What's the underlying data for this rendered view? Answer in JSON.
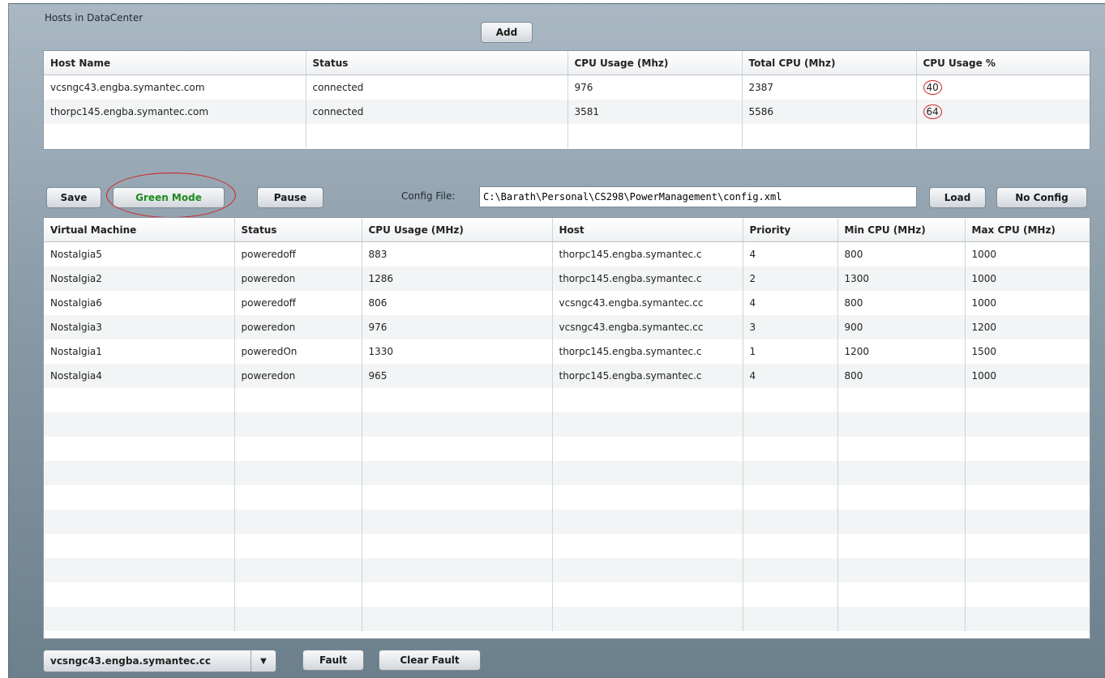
{
  "hosts": {
    "label": "Hosts in DataCenter",
    "add_label": "Add",
    "columns": [
      "Host Name",
      "Status",
      "CPU Usage (Mhz)",
      "Total CPU (Mhz)",
      "CPU Usage %"
    ],
    "rows": [
      [
        "vcsngc43.engba.symantec.com",
        "connected",
        "976",
        "2387",
        "40"
      ],
      [
        "thorpc145.engba.symantec.com",
        "connected",
        "3581",
        "5586",
        "64"
      ]
    ]
  },
  "toolbar": {
    "save_label": "Save",
    "green_mode_label": "Green Mode",
    "pause_label": "Pause",
    "config_file_label": "Config File:",
    "config_file_value": "C:\\Barath\\Personal\\CS298\\PowerManagement\\config.xml",
    "load_label": "Load",
    "no_config_label": "No Config"
  },
  "vms": {
    "columns": [
      "Virtual Machine",
      "Status",
      "CPU Usage (MHz)",
      "Host",
      "Priority",
      "Min CPU (MHz)",
      "Max CPU (MHz)"
    ],
    "rows": [
      [
        "Nostalgia5",
        "poweredoff",
        "883",
        "thorpc145.engba.symantec.c",
        "4",
        "800",
        "1000"
      ],
      [
        "Nostalgia2",
        "poweredon",
        "1286",
        "thorpc145.engba.symantec.c",
        "2",
        "1300",
        "1000"
      ],
      [
        "Nostalgia6",
        "poweredoff",
        "806",
        "vcsngc43.engba.symantec.cc",
        "4",
        "800",
        "1000"
      ],
      [
        "Nostalgia3",
        "poweredon",
        "976",
        "vcsngc43.engba.symantec.cc",
        "3",
        "900",
        "1200"
      ],
      [
        "Nostalgia1",
        "poweredOn",
        "1330",
        "thorpc145.engba.symantec.c",
        "1",
        "1200",
        "1500"
      ],
      [
        "Nostalgia4",
        "poweredon",
        "965",
        "thorpc145.engba.symantec.c",
        "4",
        "800",
        "1000"
      ]
    ]
  },
  "footer": {
    "host_select_value": "vcsngc43.engba.symantec.cc",
    "fault_label": "Fault",
    "clear_fault_label": "Clear Fault"
  },
  "colors": {
    "annotation": "#d42020",
    "green_mode_text": "#1e8a1e"
  },
  "icons": {
    "dropdown": "chevron-down-icon"
  }
}
